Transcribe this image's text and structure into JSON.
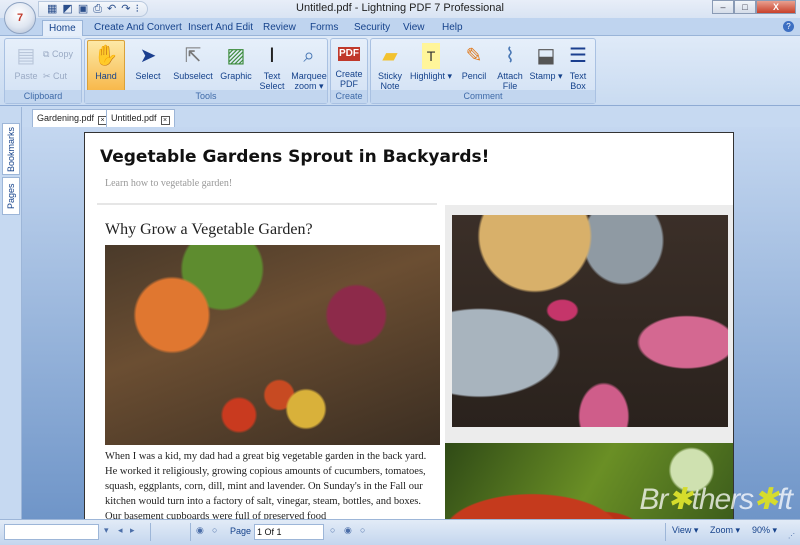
{
  "window": {
    "title": "Untitled.pdf - Lightning PDF 7 Professional",
    "app_logo": "7",
    "controls": {
      "minimize": "–",
      "maximize": "□",
      "close": "X"
    }
  },
  "quick_access": [
    {
      "name": "calendar-icon",
      "glyph": "▦"
    },
    {
      "name": "edit-icon",
      "glyph": "◩"
    },
    {
      "name": "save-icon",
      "glyph": "▣"
    },
    {
      "name": "print-icon",
      "glyph": "⎙"
    },
    {
      "name": "undo-icon",
      "glyph": "↶"
    },
    {
      "name": "redo-icon",
      "glyph": "↷"
    },
    {
      "name": "customize-icon",
      "glyph": "⁝"
    }
  ],
  "ribbon_tabs": [
    "Home",
    "Create And Convert",
    "Insert And Edit",
    "Review",
    "Forms",
    "Security",
    "View",
    "Help"
  ],
  "ribbon": {
    "clipboard": {
      "label": "Clipboard",
      "paste": "Paste",
      "copy": "Copy",
      "cut": "Cut"
    },
    "tools": {
      "label": "Tools",
      "buttons": [
        {
          "label": "Hand",
          "glyph": "✋",
          "active": true
        },
        {
          "label": "Select",
          "glyph": "➤"
        },
        {
          "label": "Subselect",
          "glyph": "⇱"
        },
        {
          "label": "Graphic",
          "glyph": "▨"
        },
        {
          "label": "Text Select",
          "glyph": "Ⅰ"
        },
        {
          "label": "Marquee zoom ▾",
          "glyph": "⌕"
        }
      ]
    },
    "create": {
      "label": "Create",
      "buttons": [
        {
          "label": "Create PDF",
          "glyph": "PDF"
        }
      ]
    },
    "comment": {
      "label": "Comment",
      "buttons": [
        {
          "label": "Sticky Note",
          "glyph": "▰"
        },
        {
          "label": "Highlight ▾",
          "glyph": "T"
        },
        {
          "label": "Pencil",
          "glyph": "✎"
        },
        {
          "label": "Attach File",
          "glyph": "⌇"
        },
        {
          "label": "Stamp ▾",
          "glyph": "⬓"
        },
        {
          "label": "Text Box",
          "glyph": "☰"
        }
      ]
    }
  },
  "side_tabs": [
    "Bookmarks",
    "Pages"
  ],
  "doc_tabs": [
    "Gardening.pdf",
    "Untitled.pdf"
  ],
  "document": {
    "title": "Vegetable Gardens Sprout in Backyards!",
    "subtitle": "Learn how to vegetable garden!",
    "section_heading": "Why Grow a Vegetable Garden?",
    "body": "When I was a kid, my dad had a great big vegetable garden in the back yard. He worked it religiously, growing copious amounts of cucumbers, tomatoes, squash, eggplants, corn, dill, mint and lavender. On Sunday's in the Fall our kitchen would turn into a factory of salt, vinegar, steam, bottles, and boxes. Our basement cupboards were full of preserved food"
  },
  "watermark": {
    "text1": "Br",
    "star": "✱",
    "text2": "thers",
    "text3": "ft"
  },
  "statusbar": {
    "page_label": "Page",
    "page_value": "1 Of 1",
    "view": "View ▾",
    "zoom": "Zoom ▾",
    "zoom_value": "90% ▾"
  }
}
